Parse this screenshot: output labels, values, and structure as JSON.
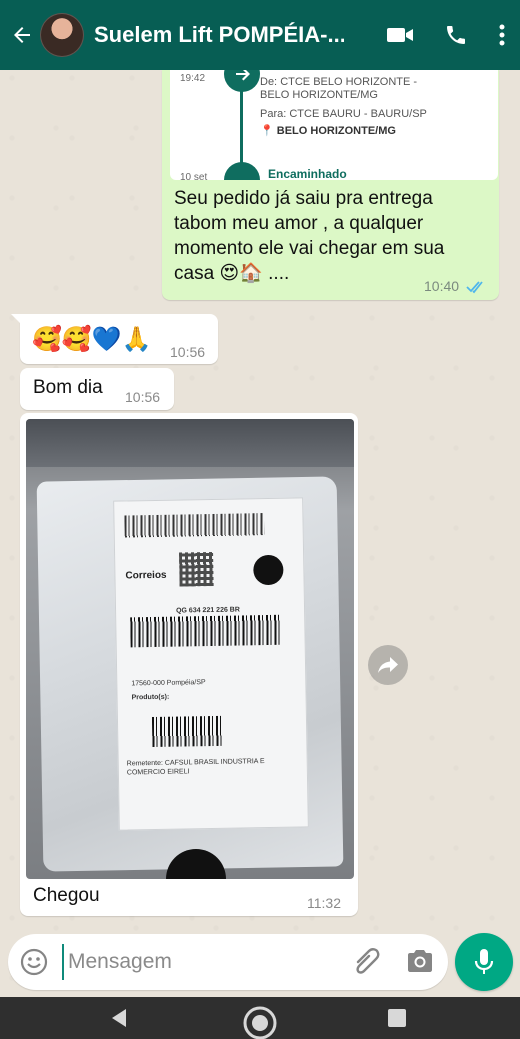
{
  "header": {
    "contact_name": "Suelem Lift POMPÉIA-..."
  },
  "tracking_card": {
    "time_1": "19:42",
    "from_label": "De:",
    "from_value": "CTCE BELO HORIZONTE - BELO HORIZONTE/MG",
    "to_label": "Para:",
    "to_value": "CTCE BAURU - BAURU/SP",
    "location": "BELO HORIZONTE/MG",
    "time_2": "10 set",
    "status": "Encaminhado"
  },
  "messages": [
    {
      "direction": "out",
      "text_lines": [
        "Seu pedido já saiu pra entrega",
        "tabom meu amor , a qualquer",
        "momento ele vai chegar em sua",
        "casa 😍🏠 ...."
      ],
      "time": "10:40",
      "status_icon": "double-check-blue"
    },
    {
      "direction": "in",
      "text": "🥰🥰💙🙏",
      "time": "10:56"
    },
    {
      "direction": "in",
      "text": "Bom dia",
      "time": "10:56"
    },
    {
      "direction": "in",
      "type": "image",
      "caption": "Chegou",
      "time": "11:32",
      "image_text": {
        "brand": "Correios",
        "tracking": "QG 634 221 226 BR",
        "remetente": "Remetente: CAFSUL BRASIL INDUSTRIA E COMERCIO EIRELI",
        "cep": "17560-000 Pompéia/SP",
        "produtos": "Produto(s):"
      }
    }
  ],
  "composer": {
    "placeholder": "Mensagem"
  },
  "icons": {
    "back": "arrow-left-icon",
    "video": "video-call-icon",
    "call": "phone-icon",
    "menu": "more-vert-icon",
    "emoji": "emoji-icon",
    "attach": "paperclip-icon",
    "camera": "camera-icon",
    "mic": "mic-icon",
    "forward": "forward-icon"
  },
  "colors": {
    "header": "#075e54",
    "outgoing_bubble": "#dcf8c6",
    "incoming_bubble": "#ffffff",
    "accent": "#00a884",
    "read_ticks": "#4fb6ec"
  }
}
